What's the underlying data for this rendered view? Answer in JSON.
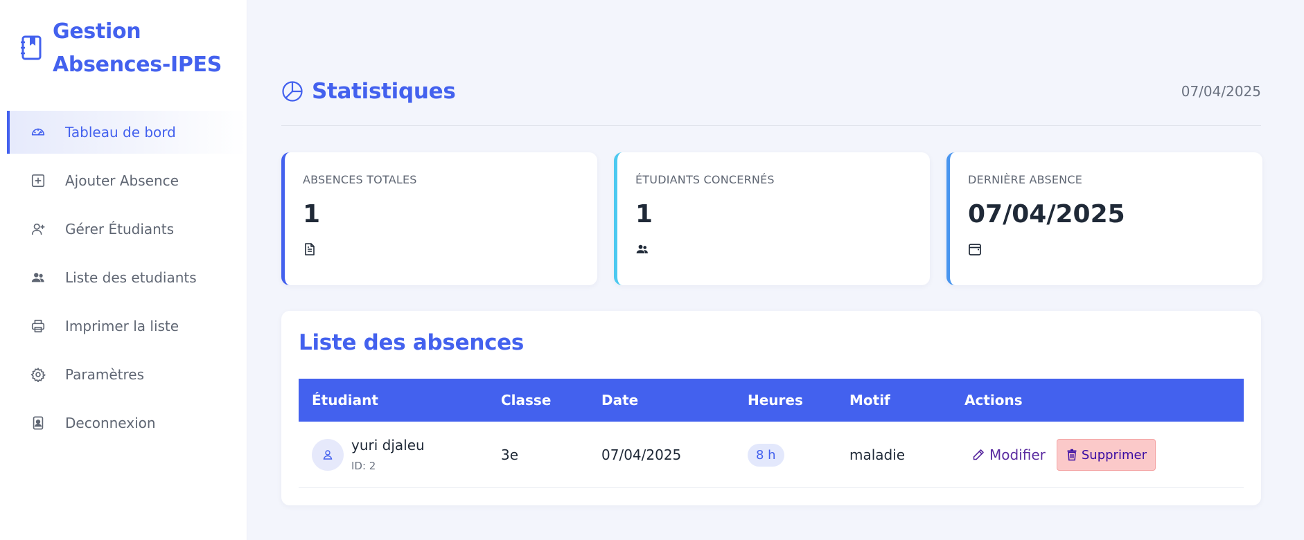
{
  "app": {
    "title": "Gestion Absences-IPES",
    "icon": "notebook-icon",
    "accent_color": "#4361ee"
  },
  "sidebar": {
    "items": [
      {
        "label": "Tableau de bord",
        "icon": "dashboard-gauge-icon",
        "active": true
      },
      {
        "label": "Ajouter Absence",
        "icon": "plus-square-icon",
        "active": false
      },
      {
        "label": "Gérer Étudiants",
        "icon": "user-plus-icon",
        "active": false
      },
      {
        "label": "Liste des etudiants",
        "icon": "users-icon",
        "active": false
      },
      {
        "label": "Imprimer la liste",
        "icon": "printer-icon",
        "active": false
      },
      {
        "label": "Paramètres",
        "icon": "gear-icon",
        "active": false
      },
      {
        "label": "Deconnexion",
        "icon": "badge-person-icon",
        "active": false
      }
    ]
  },
  "header": {
    "title": "Statistiques",
    "icon": "pie-chart-icon",
    "date": "07/04/2025"
  },
  "stats": [
    {
      "label": "ABSENCES TOTALES",
      "value": "1",
      "icon": "document-icon",
      "color": "#4361ee"
    },
    {
      "label": "ÉTUDIANTS CONCERNÉS",
      "value": "1",
      "icon": "users-icon",
      "color": "#4cc9f0"
    },
    {
      "label": "DERNIÈRE ABSENCE",
      "value": "07/04/2025",
      "icon": "calendar-icon",
      "color": "#4895ef"
    }
  ],
  "absences": {
    "title": "Liste des absences",
    "columns": [
      "Étudiant",
      "Classe",
      "Date",
      "Heures",
      "Motif",
      "Actions"
    ],
    "rows": [
      {
        "student_name": "yuri djaleu",
        "student_id": "ID: 2",
        "classe": "3e",
        "date": "07/04/2025",
        "heures": "8 h",
        "motif": "maladie",
        "edit_label": "Modifier",
        "delete_label": "Supprimer"
      }
    ]
  }
}
